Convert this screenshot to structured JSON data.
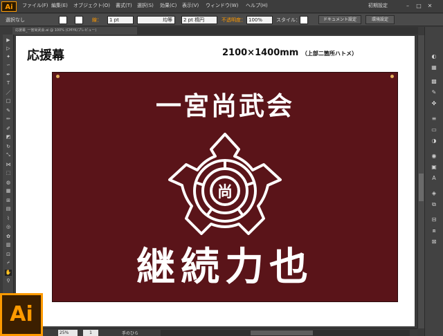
{
  "app": {
    "logo": "Ai",
    "badge": "Ai",
    "workspace": "初期設定"
  },
  "menu": [
    "ファイル(F)",
    "編集(E)",
    "オブジェクト(O)",
    "書式(T)",
    "選択(S)",
    "効果(C)",
    "表示(V)",
    "ウィンドウ(W)",
    "ヘルプ(H)"
  ],
  "controlbar": {
    "selection": "選択なし",
    "stroke_label": "線：",
    "stroke_weight": "1 pt",
    "profile": "均等",
    "brush": "2 pt 楕円",
    "opacity_label": "不透明度：",
    "opacity_value": "100%",
    "style_label": "スタイル：",
    "doc_setup": "ドキュメント設定",
    "prefs": "環境設定"
  },
  "document": {
    "tab_label": "応援幕_一宮尚武会.ai @ 100% (CMYK/プレビュー)"
  },
  "artboard": {
    "heading": "応援幕",
    "size": "2100×1400mm",
    "size_note": "（上部二箇所ハトメ）",
    "banner": {
      "org_name": "一宮尚武会",
      "emblem_char": "尚",
      "slogan": "継続力也",
      "bg_color": "#5a1419"
    }
  },
  "statusbar": {
    "zoom": "25%",
    "artboard_num": "1",
    "tool_name": "手のひら"
  },
  "colors": {
    "accent": "#ff9a00",
    "banner": "#5a1419"
  }
}
